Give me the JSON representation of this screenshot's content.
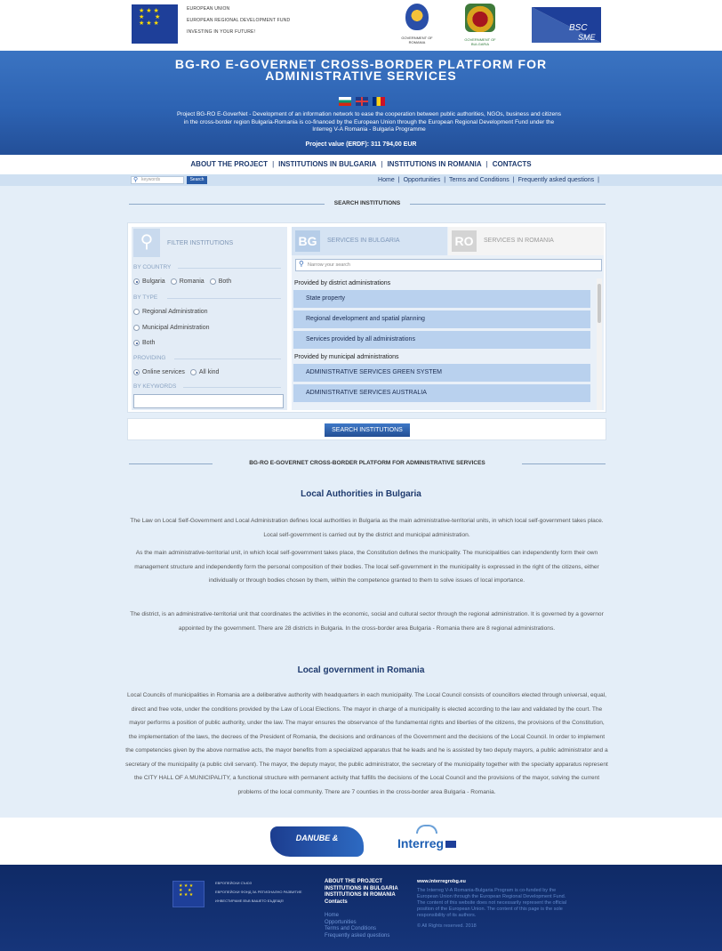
{
  "top_logos": {
    "eu_lines": [
      "EUROPEAN UNION",
      "EUROPEAN REGIONAL DEVELOPMENT FUND",
      "INVESTING IN YOUR FUTURE!"
    ],
    "gov_ro_caption": "GOVERNMENT OF ROMANIA",
    "gov_bg_caption": "GOVERNMENT OF BULGARIA",
    "bsc_text": "BSC",
    "sme_text": "SME"
  },
  "banner": {
    "title": "BG-RO E-GOVERNET CROSS-BORDER PLATFORM FOR ADMINISTRATIVE SERVICES",
    "description": "Project BG-RO E-GoverNet - Development of an information network to ease the cooperation between public authorities, NGOs, business and citizens in the cross-border region Bulgaria-Romania is co-financed by the European Union through the European Regional Development Fund under the Interreg V-A Romania - Bulgaria Programme",
    "project_value": "Project value (ERDF): 311 794,00 EUR"
  },
  "main_nav": [
    "ABOUT THE PROJECT",
    "INSTITUTIONS IN BULGARIA",
    "INSTITUTIONS IN ROMANIA",
    "CONTACTS"
  ],
  "sub_nav": {
    "search_placeholder": "keywords",
    "search_button": "Search",
    "links": [
      "Home",
      "Opportunities",
      "Terms and Conditions",
      "Frequently asked questions"
    ]
  },
  "search_section": {
    "title": "SEARCH INSTITUTIONS",
    "filter": {
      "label": "FILTER INSTITUTIONS",
      "by_country": "BY COUNTRY",
      "country_options": [
        "Bulgaria",
        "Romania",
        "Both"
      ],
      "country_selected": "Bulgaria",
      "by_type": "BY TYPE",
      "type_options": [
        "Regional Administration",
        "Municipal Administration",
        "Both"
      ],
      "type_selected": "Both",
      "providing": "PROVIDING",
      "providing_options": [
        "Online services",
        "All kind"
      ],
      "providing_selected": "Online services",
      "by_keywords": "BY KEYWORDS"
    },
    "tabs": {
      "bg_badge": "BG",
      "bg_label": "SERVICES IN BULGARIA",
      "ro_badge": "RO",
      "ro_label": "SERVICES IN ROMANIA"
    },
    "services_search_placeholder": "Narrow your search",
    "groups": [
      {
        "heading": "Provided by district administrations",
        "items": [
          "State property",
          "Regional development and spatial planning",
          "Services provided by all administrations"
        ]
      },
      {
        "heading": "Provided by municipal administrations",
        "items": [
          "ADMINISTRATIVE SERVICES GREEN SYSTEM",
          "ADMINISTRATIVE SERVICES AUSTRALIA"
        ]
      }
    ],
    "search_button": "SEARCH INSTITUTIONS"
  },
  "article": {
    "section_title": "BG-RO E-GOVERNET CROSS-BORDER PLATFORM FOR ADMINISTRATIVE SERVICES",
    "h1": "Local Authorities in Bulgaria",
    "p1": "The Law on Local Self-Government and Local Administration defines local authorities in Bulgaria as the main administrative-territorial units, in which local self-government takes place. Local self-government is carried out by the district and municipal administration.",
    "p2": "As the main administrative-territorial unit, in which local self-government takes place, the Constitution defines the municipality. The municipalities can independently form their own management structure and independently form the personal composition of their bodies. The local self-government in the municipality is expressed in the right of the citizens, either individually or through bodies chosen by them, within the competence granted to them to solve issues of local importance.",
    "p3": "The district, is an administrative-territorial unit that coordinates the activities in the economic, social and cultural sector through the regional administration. It is governed by a governor appointed by the government. There are 28 districts in Bulgaria. In the cross-border area Bulgaria - Romania there are 8 regional administrations.",
    "h2": "Local government in Romania",
    "p4": "Local Councils of municipalities in Romania are a deliberative authority with headquarters in each municipality. The Local Council consists of councillors elected through universal, equal, direct and free vote, under the conditions provided by the Law of Local Elections. The mayor in charge of a municipality is elected according to the law and validated by the court. The mayor performs a position of public authority, under the law. The mayor ensures the observance of the fundamental rights and liberties of the citizens, the provisions of the Constitution, the implementation of the laws, the decrees of the President of Romania, the decisions and ordinances of the Government and the decisions of the Local Council. In order to implement the competencies given by the above normative acts, the mayor benefits from a specialized apparatus that he leads and he is assisted by two deputy mayors, a public administrator and a secretary of the municipality (a public civil servant). The mayor, the deputy mayor, the public administrator, the secretary of the municipality together with the specialty apparatus represent the CITY HALL OF A MUNICIPALITY, a functional structure with permanent activity that fulfills the decisions of the Local Council and the provisions of the mayor, solving the current problems of the local community. There are 7 counties in the cross-border area Bulgaria - Romania."
  },
  "partners": {
    "danube_text": "DANUBE &",
    "interreg_text": "Interreg"
  },
  "footer": {
    "eu_lines": [
      "ЕВРОПЕЙСКИ СЪЮЗ",
      "ЕВРОПЕЙСКИ ФОНД ЗА РЕГИОНАЛНО РАЗВИТИЕ",
      "ИНВЕСТИРАМЕ ВЪВ ВАШЕТО БЪДЕЩЕ!"
    ],
    "nav_primary": [
      "ABOUT THE PROJECT",
      "INSTITUTIONS IN BULGARIA",
      "INSTITUTIONS IN ROMANIA",
      "Contacts"
    ],
    "nav_secondary": [
      "Home",
      "Opportunities",
      "Terms and Conditions",
      "Frequently asked questions"
    ],
    "site": "www.interregrobg.eu",
    "disclaimer": "The Interreg V-A Romania-Bulgaria Program is co-funded by the European Union through the European Regional Development Fund. The content of this website does not necessarily represent the official position of the European Union. The content of this page is the sole responsibility of its authors.",
    "copyright": "© All Rights reserved. 2018"
  }
}
